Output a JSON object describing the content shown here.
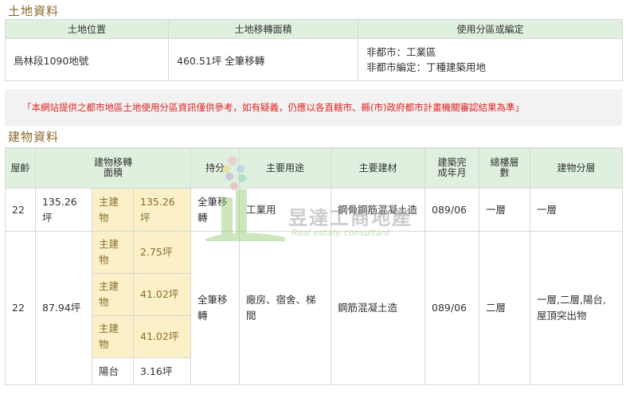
{
  "land": {
    "title": "土地資料",
    "headers": [
      "土地位置",
      "土地移轉面積",
      "使用分區或編定"
    ],
    "location": "鳥林段1090地號",
    "transfer_area": "460.51坪 全筆移轉",
    "zoning_line1": "非都市：工業區",
    "zoning_line2": "非都市編定：丁種建築用地"
  },
  "notice": "「本網站提供之都市地區土地使用分區資訊僅供參考，如有疑義，仍應以各直轄市、縣(市)政府都市計畫機關審認結果為準」",
  "building": {
    "title": "建物資料",
    "headers": {
      "age": "屋齡",
      "transfer_area": "建物移轉面積",
      "share": "持分",
      "use": "主要用途",
      "material": "主要建材",
      "built_date": "建築完成年月",
      "total_floors": "總樓層數",
      "floor": "建物分層"
    },
    "rows": [
      {
        "age": "22",
        "area": "135.26坪",
        "parts": [
          {
            "label": "主建物",
            "area": "135.26坪"
          }
        ],
        "share": "全筆移轉",
        "use": "工業用",
        "material": "鋼骨鋼筋混凝土造",
        "built": "089/06",
        "floors": "一層",
        "floor_detail": "一層"
      },
      {
        "age": "22",
        "area": "87.94坪",
        "parts": [
          {
            "label": "主建物",
            "area": "2.75坪"
          },
          {
            "label": "主建物",
            "area": "41.02坪"
          },
          {
            "label": "主建物",
            "area": "41.02坪"
          },
          {
            "label": "陽台",
            "area": "3.16坪"
          }
        ],
        "share": "全筆移轉",
        "use": "廠房、宿舍、梯間",
        "material": "鋼筋混凝土造",
        "built": "089/06",
        "floors": "二層",
        "floor_detail": "一層,二層,陽台,屋頂突出物"
      }
    ]
  },
  "watermark": {
    "name": "昱達工商地產",
    "subtitle": "Real estate consultant"
  },
  "colors": {
    "header_bg": "#dff0df",
    "highlight_bg": "#fbf0c8",
    "title_color": "#8c6a2c",
    "notice_color": "#dd2222"
  }
}
